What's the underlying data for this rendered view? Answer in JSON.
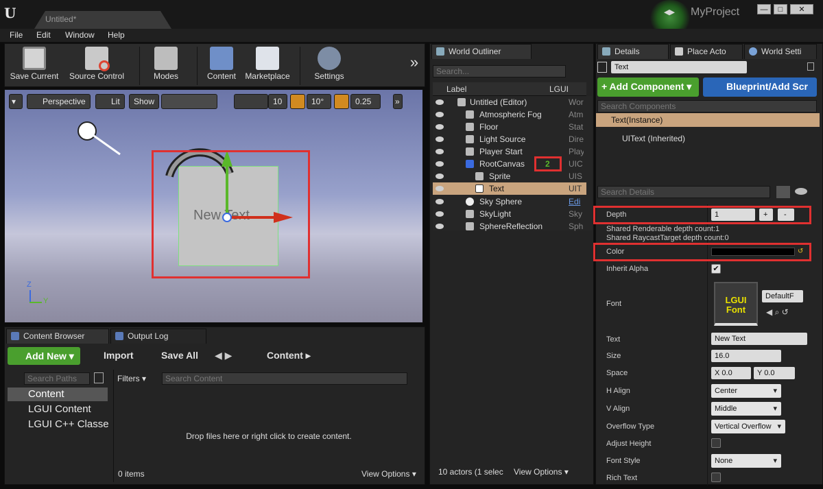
{
  "title_bar": {
    "doc_tab": "Untitled*",
    "project_name": "MyProject",
    "min": "—",
    "max": "□",
    "close": "✕"
  },
  "menu": [
    "File",
    "Edit",
    "Window",
    "Help"
  ],
  "toolbar": {
    "save_current": "Save Current",
    "source_control": "Source Control",
    "modes": "Modes",
    "content": "Content",
    "marketplace": "Marketplace",
    "settings": "Settings",
    "more": "»"
  },
  "viewport": {
    "perspective": "Perspective",
    "lit": "Lit",
    "show": "Show",
    "grid_snap": "10",
    "rot_snap": "10°",
    "scale_snap": "0.25",
    "text_in_scene": "New Text",
    "axis_z": "Z",
    "axis_y": "Y"
  },
  "outliner": {
    "tab": "World Outliner",
    "search_placeholder": "Search...",
    "col_label": "Label",
    "col_type": "LGUI",
    "rows": [
      {
        "label": "Untitled (Editor)",
        "type": "Wor"
      },
      {
        "label": "Atmospheric Fog",
        "type": "Atm"
      },
      {
        "label": "Floor",
        "type": "Stat"
      },
      {
        "label": "Light Source",
        "type": "Dire"
      },
      {
        "label": "Player Start",
        "type": "Play"
      },
      {
        "label": "RootCanvas",
        "type": "UIC",
        "badge": "2"
      },
      {
        "label": "Sprite",
        "type": "UIS"
      },
      {
        "label": "Text",
        "type": "UIT"
      },
      {
        "label": "Sky Sphere",
        "type": "Edi"
      },
      {
        "label": "SkyLight",
        "type": "Sky"
      },
      {
        "label": "SphereReflection",
        "type": "Sph"
      }
    ],
    "footer": "10 actors (1 selec",
    "view_options": "View Options"
  },
  "details": {
    "tabs": [
      "Details",
      "Place Acto",
      "World Setti"
    ],
    "name": "Text",
    "add_component": "+ Add Component",
    "blueprint": "Blueprint/Add Scr",
    "search_components": "Search Components",
    "comp_instance": "Text(Instance)",
    "comp_inherited": "UIText (Inherited)",
    "search_details": "Search Details",
    "depth_label": "Depth",
    "depth_value": "1",
    "plus": "+",
    "minus": "-",
    "shared_render": "Shared Renderable depth count:1",
    "shared_raycast": "Shared RaycastTarget depth count:0",
    "color_label": "Color",
    "inherit_alpha": "Inherit Alpha",
    "font_label": "Font",
    "font_thumb": "LGUI Font",
    "font_value": "DefaultF",
    "text_label": "Text",
    "text_value": "New Text",
    "size_label": "Size",
    "size_value": "16.0",
    "space_label": "Space",
    "space_x": "X  0.0",
    "space_y": "Y  0.0",
    "halign_label": "H Align",
    "halign_value": "Center",
    "valign_label": "V Align",
    "valign_value": "Middle",
    "overflow_label": "Overflow Type",
    "overflow_value": "Vertical Overflow",
    "adjust_height": "Adjust Height",
    "font_style_label": "Font Style",
    "font_style_value": "None",
    "rich_text": "Rich Text"
  },
  "content_browser": {
    "tab": "Content Browser",
    "tab2": "Output Log",
    "add_new": "Add New",
    "import": "Import",
    "save_all": "Save All",
    "path": "Content",
    "search_paths": "Search Paths",
    "filters": "Filters",
    "search_content": "Search Content",
    "folders": [
      "Content",
      "LGUI Content",
      "LGUI C++ Classe"
    ],
    "empty_msg": "Drop files here or right click to create content.",
    "items": "0 items",
    "view_options": "View Options"
  }
}
